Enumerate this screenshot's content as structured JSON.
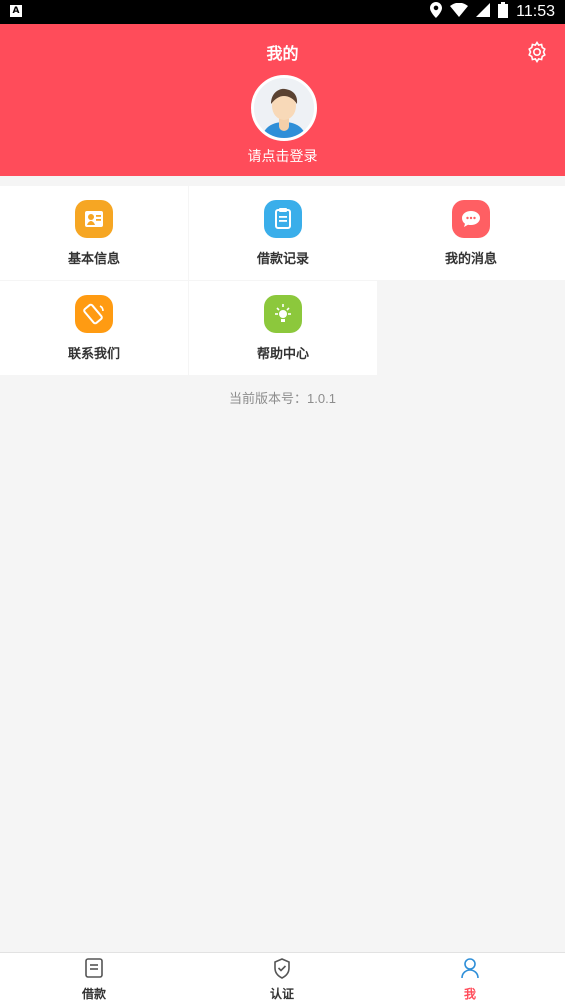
{
  "status_bar": {
    "time": "11:53"
  },
  "header": {
    "title": "我的",
    "login_text": "请点击登录"
  },
  "grid": {
    "items": [
      {
        "label": "基本信息",
        "icon": "id-card-icon",
        "color": "#f6a623"
      },
      {
        "label": "借款记录",
        "icon": "clipboard-icon",
        "color": "#3aaeea"
      },
      {
        "label": "我的消息",
        "icon": "chat-icon",
        "color": "#ff5f63"
      },
      {
        "label": "联系我们",
        "icon": "phone-icon",
        "color": "#ff9b12"
      },
      {
        "label": "帮助中心",
        "icon": "lightbulb-icon",
        "color": "#8cc83c"
      }
    ]
  },
  "version_text": "当前版本号：1.0.1",
  "bottom_nav": {
    "items": [
      {
        "label": "借款",
        "icon": "loan-icon"
      },
      {
        "label": "认证",
        "icon": "shield-icon"
      },
      {
        "label": "我",
        "icon": "user-icon",
        "active": true
      }
    ]
  },
  "colors": {
    "accent": "#ff4c5a"
  }
}
